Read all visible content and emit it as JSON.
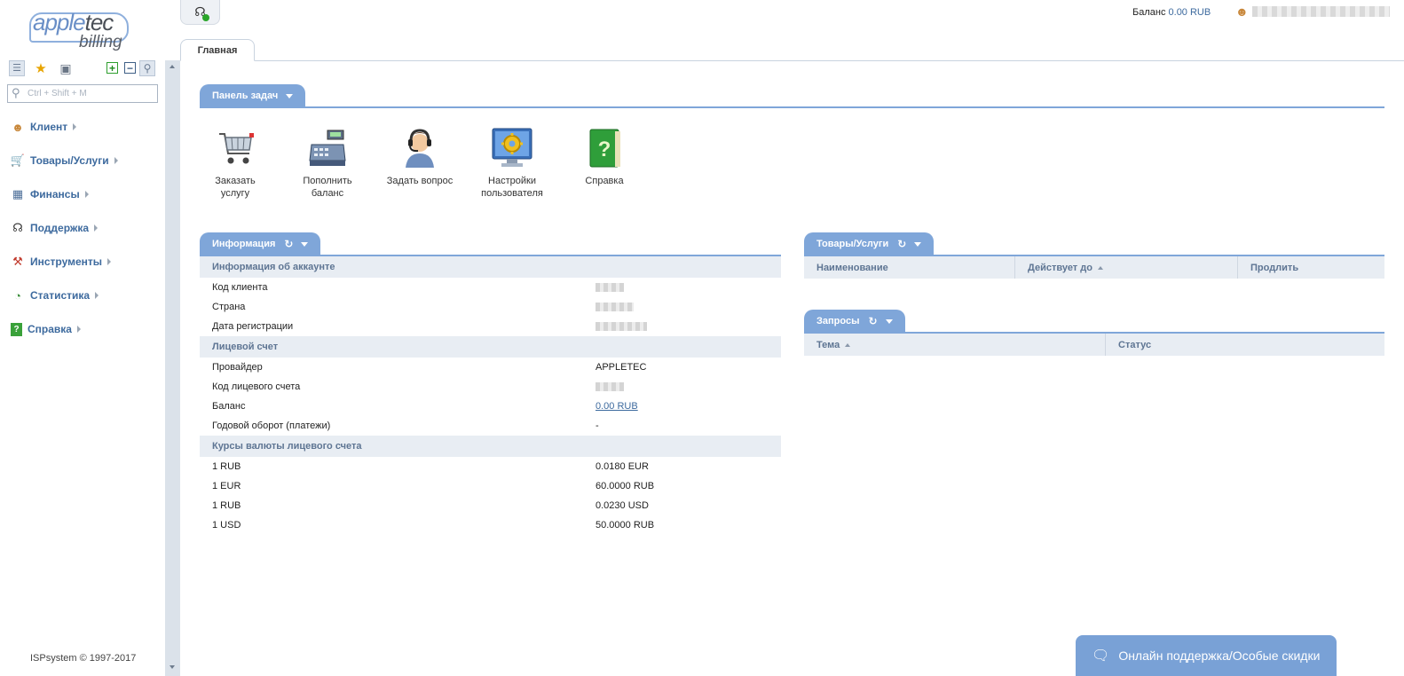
{
  "logo": {
    "line1a": "apple",
    "line1b": "tec",
    "line2": "billing"
  },
  "sidebar": {
    "search_placeholder": "Ctrl + Shift + M",
    "items": [
      {
        "label": "Клиент",
        "icon": "client-icon"
      },
      {
        "label": "Товары/Услуги",
        "icon": "cart-icon"
      },
      {
        "label": "Финансы",
        "icon": "finance-icon"
      },
      {
        "label": "Поддержка",
        "icon": "headset-icon"
      },
      {
        "label": "Инструменты",
        "icon": "tools-icon"
      },
      {
        "label": "Статистика",
        "icon": "pie-chart-icon"
      },
      {
        "label": "Справка",
        "icon": "help-book-icon"
      }
    ],
    "copyright": "ISPsystem © 1997-2017"
  },
  "topbar": {
    "balance_label": "Баланс",
    "balance_value": "0.00 RUB"
  },
  "tabs": [
    {
      "label": "Главная"
    }
  ],
  "taskpanel": {
    "title": "Панель задач",
    "items": [
      {
        "label1": "Заказать",
        "label2": "услугу",
        "icon": "shopping-cart-icon"
      },
      {
        "label1": "Пополнить",
        "label2": "баланс",
        "icon": "cash-register-icon"
      },
      {
        "label1": "Задать вопрос",
        "label2": "",
        "icon": "support-operator-icon"
      },
      {
        "label1": "Настройки",
        "label2": "пользователя",
        "icon": "settings-monitor-icon"
      },
      {
        "label1": "Справка",
        "label2": "",
        "icon": "help-book-icon"
      }
    ]
  },
  "info": {
    "title": "Информация",
    "groups": [
      {
        "title": "Информация об аккаунте",
        "rows": [
          {
            "key": "Код клиента",
            "value": ""
          },
          {
            "key": "Страна",
            "value": ""
          },
          {
            "key": "Дата регистрации",
            "value": ""
          }
        ]
      },
      {
        "title": "Лицевой счет",
        "rows": [
          {
            "key": "Провайдер",
            "value": "APPLETEC"
          },
          {
            "key": "Код лицевого счета",
            "value": ""
          },
          {
            "key": "Баланс",
            "value": "0.00 RUB"
          },
          {
            "key": "Годовой оборот (платежи)",
            "value": "-"
          }
        ]
      },
      {
        "title": "Курсы валюты лицевого счета",
        "rows": [
          {
            "key": "1 RUB",
            "value": "0.0180 EUR"
          },
          {
            "key": "1 EUR",
            "value": "60.0000 RUB"
          },
          {
            "key": "1 RUB",
            "value": "0.0230 USD"
          },
          {
            "key": "1 USD",
            "value": "50.0000 RUB"
          }
        ]
      }
    ]
  },
  "products": {
    "title": "Товары/Услуги",
    "columns": [
      "Наименование",
      "Действует до",
      "Продлить"
    ]
  },
  "requests": {
    "title": "Запросы",
    "columns": [
      "Тема",
      "Статус"
    ]
  },
  "chat": {
    "label": "Онлайн поддержка/Особые скидки"
  }
}
